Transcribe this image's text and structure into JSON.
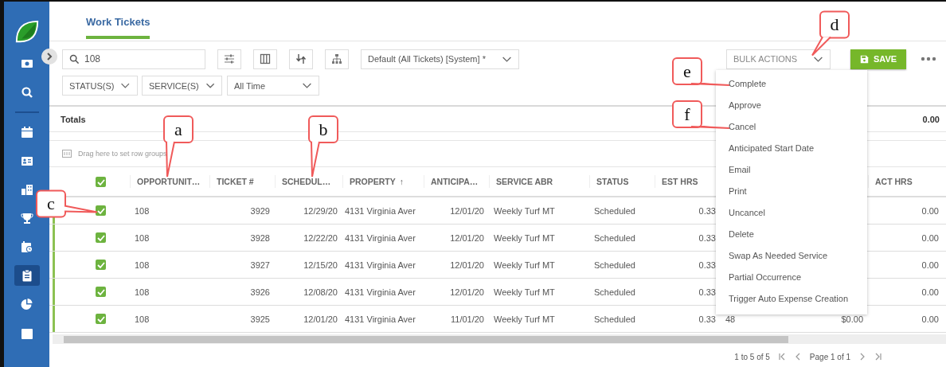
{
  "sidebar": {
    "items": [
      {
        "selected": false
      },
      {
        "selected": false
      },
      {
        "selected": false
      },
      {
        "selected": false
      },
      {
        "selected": false
      },
      {
        "selected": false
      },
      {
        "selected": false
      },
      {
        "selected": true
      },
      {
        "selected": false
      },
      {
        "selected": false
      }
    ]
  },
  "tab": {
    "label": "Work Tickets",
    "selected": true
  },
  "toolbar": {
    "search": {
      "value": "108"
    },
    "view": {
      "value": "Default (All Tickets) [System] *"
    },
    "bulk_actions": {
      "label": "BULK ACTIONS",
      "expanded": true,
      "callout": "d"
    },
    "save": {
      "label": "SAVE"
    }
  },
  "filters": [
    {
      "label": "STATUS(S)"
    },
    {
      "label": "SERVICE(S)"
    },
    {
      "label": "All Time"
    }
  ],
  "totals": {
    "label": "Totals",
    "column_12": "0.00"
  },
  "group_bar": {
    "text": "Drag here to set row groups"
  },
  "bulk_menu": {
    "items": [
      {
        "label": "Complete",
        "callout": "e"
      },
      {
        "label": "Approve"
      },
      {
        "label": "Cancel",
        "callout": "f"
      },
      {
        "label": "Anticipated Start Date"
      },
      {
        "label": "Email"
      },
      {
        "label": "Print"
      },
      {
        "label": "Uncancel"
      },
      {
        "label": "Delete"
      },
      {
        "label": "Swap As Needed Service"
      },
      {
        "label": "Partial Occurrence"
      },
      {
        "label": "Trigger Auto Expense Creation"
      }
    ]
  },
  "table": {
    "header_checkbox": {
      "checked": true
    },
    "columns": [
      {
        "label": "OPPORTUNIT…",
        "kind": "text",
        "callout": "a"
      },
      {
        "label": "TICKET #",
        "kind": "number"
      },
      {
        "label": "SCHEDUL…",
        "kind": "number",
        "callout": "b"
      },
      {
        "label": "PROPERTY",
        "sort": "↑",
        "kind": "text"
      },
      {
        "label": "ANTICIPA…",
        "kind": "number"
      },
      {
        "label": "SERVICE ABR",
        "kind": "text"
      },
      {
        "label": "STATUS",
        "kind": "text"
      },
      {
        "label": "EST HRS",
        "kind": "number"
      },
      {
        "kind": "text"
      },
      {
        "kind": "number"
      },
      {
        "label": "ACT HRS",
        "kind": "number"
      }
    ],
    "rows": [
      {
        "checked": true,
        "callout": "c",
        "cells": [
          "108",
          "3929",
          "12/29/20",
          "4131 Virginia Aver",
          "12/01/20",
          "Weekly Turf MT",
          "Scheduled",
          "0.33",
          null,
          null,
          "0.00"
        ]
      },
      {
        "checked": true,
        "cells": [
          "108",
          "3928",
          "12/22/20",
          "4131 Virginia Aver",
          "12/01/20",
          "Weekly Turf MT",
          "Scheduled",
          "0.33",
          null,
          null,
          "0.00"
        ]
      },
      {
        "checked": true,
        "cells": [
          "108",
          "3927",
          "12/15/20",
          "4131 Virginia Aver",
          "12/01/20",
          "Weekly Turf MT",
          "Scheduled",
          "0.33",
          null,
          null,
          "0.00"
        ]
      },
      {
        "checked": true,
        "cells": [
          "108",
          "3926",
          "12/08/20",
          "4131 Virginia Aver",
          "12/01/20",
          "Weekly Turf MT",
          "Scheduled",
          "0.33",
          null,
          null,
          "0.00"
        ]
      },
      {
        "checked": true,
        "cells": [
          "108",
          "3925",
          "12/01/20",
          "4131 Virginia Aver",
          "11/01/20",
          "Weekly Turf MT",
          "Scheduled",
          "0.33",
          "48",
          "$0.00",
          "0.00"
        ]
      }
    ]
  },
  "pagination": {
    "summary": "1 to 5 of 5",
    "page": "Page 1 of 1"
  }
}
